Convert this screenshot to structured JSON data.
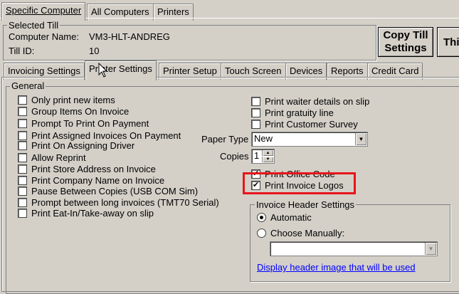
{
  "top_tabs": [
    "Specific Computer",
    "All Computers",
    "Printers"
  ],
  "selected_till": {
    "legend": "Selected Till",
    "computer_name_label": "Computer Name:",
    "computer_name_value": "VM3-HLT-ANDREG",
    "till_id_label": "Till ID:",
    "till_id_value": "10"
  },
  "copy_till_button": [
    "Copy Till",
    "Settings"
  ],
  "partial_button": "Thi",
  "sub_tabs": [
    "Invoicing Settings",
    "Printer Settings",
    "Printer Setup",
    "Touch Screen",
    "Devices",
    "Reports",
    "Credit Card"
  ],
  "general": {
    "legend": "General",
    "left_checkboxes": [
      {
        "label": "Only print new items",
        "checked": false
      },
      {
        "label": "Group Items On Invoice",
        "checked": false
      },
      {
        "label": "Prompt To Print On Payment",
        "checked": false
      },
      {
        "label": "Print Assigned Invoices On Payment",
        "checked": false
      },
      {
        "label": "Print On Assigning Driver",
        "checked": false
      },
      {
        "label": "Allow Reprint",
        "checked": false
      },
      {
        "label": "Print Store Address on Invoice",
        "checked": false
      },
      {
        "label": "Print Company Name on Invoice",
        "checked": false
      },
      {
        "label": "Pause Between Copies (USB COM Sim)",
        "checked": false
      },
      {
        "label": "Prompt between long invoices (TMT70 Serial)",
        "checked": false
      },
      {
        "label": "Print Eat-In/Take-away on slip",
        "checked": false
      }
    ],
    "right_checkboxes": [
      {
        "label": "Print waiter details on slip",
        "checked": false
      },
      {
        "label": "Print gratuity line",
        "checked": false
      },
      {
        "label": "Print Customer Survey",
        "checked": false
      }
    ],
    "paper_type_label": "Paper Type",
    "paper_type_value": "New",
    "copies_label": "Copies",
    "copies_value": "1",
    "print_office_code": {
      "label": "Print Office Code",
      "checked": true
    },
    "print_invoice_logos": {
      "label": "Print Invoice Logos",
      "checked": true
    },
    "invoice_header": {
      "legend": "Invoice Header Settings",
      "automatic_label": "Automatic",
      "choose_manually_label": "Choose Manually:",
      "link": "Display header image that will be used"
    }
  },
  "colors": {
    "highlight_box": "#e8141b",
    "link": "#0000ff",
    "face": "#d4d0c8"
  }
}
